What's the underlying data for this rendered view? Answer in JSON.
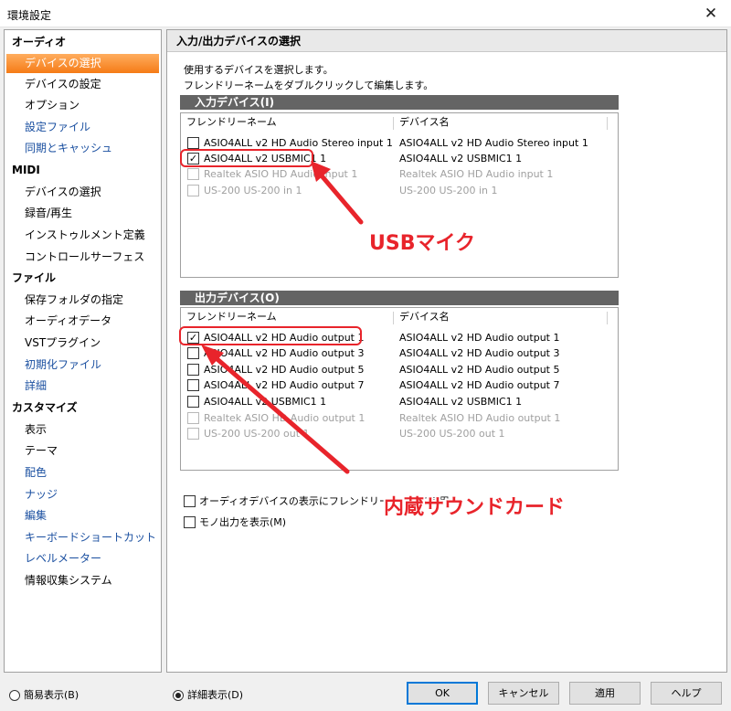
{
  "window": {
    "title": "環境設定",
    "close_icon": "close-icon"
  },
  "sidebar": {
    "items": [
      {
        "label": "オーディオ",
        "kind": "category"
      },
      {
        "label": "デバイスの選択",
        "kind": "selected"
      },
      {
        "label": "デバイスの設定",
        "kind": "sub"
      },
      {
        "label": "オプション",
        "kind": "sub"
      },
      {
        "label": "設定ファイル",
        "kind": "link"
      },
      {
        "label": "同期とキャッシュ",
        "kind": "link"
      },
      {
        "label": "MIDI",
        "kind": "category"
      },
      {
        "label": "デバイスの選択",
        "kind": "sub"
      },
      {
        "label": "録音/再生",
        "kind": "sub"
      },
      {
        "label": "インストゥルメント定義",
        "kind": "sub"
      },
      {
        "label": "コントロールサーフェス",
        "kind": "sub"
      },
      {
        "label": "ファイル",
        "kind": "category"
      },
      {
        "label": "保存フォルダの指定",
        "kind": "sub"
      },
      {
        "label": "オーディオデータ",
        "kind": "sub"
      },
      {
        "label": "VSTプラグイン",
        "kind": "sub"
      },
      {
        "label": "初期化ファイル",
        "kind": "link"
      },
      {
        "label": "詳細",
        "kind": "link"
      },
      {
        "label": "カスタマイズ",
        "kind": "category"
      },
      {
        "label": "表示",
        "kind": "sub"
      },
      {
        "label": "テーマ",
        "kind": "sub"
      },
      {
        "label": "配色",
        "kind": "link"
      },
      {
        "label": "ナッジ",
        "kind": "link"
      },
      {
        "label": "編集",
        "kind": "link"
      },
      {
        "label": "キーボードショートカット",
        "kind": "link"
      },
      {
        "label": "レベルメーター",
        "kind": "link"
      },
      {
        "label": "情報収集システム",
        "kind": "sub"
      }
    ]
  },
  "main": {
    "header": "入力/出力デバイスの選択",
    "desc1": "使用するデバイスを選択します。",
    "desc2": "フレンドリーネームをダブルクリックして編集します。",
    "input_group": {
      "title": "入力デバイス(I)",
      "col_friendly": "フレンドリーネーム",
      "col_device": "デバイス名",
      "rows": [
        {
          "friendly": "ASIO4ALL v2 HD Audio Stereo input 1",
          "device": "ASIO4ALL v2 HD Audio Stereo input 1",
          "checked": false,
          "enabled": true
        },
        {
          "friendly": "ASIO4ALL v2 USBMIC1 1",
          "device": "ASIO4ALL v2 USBMIC1 1",
          "checked": true,
          "enabled": true
        },
        {
          "friendly": "Realtek ASIO HD Audio input 1",
          "device": "Realtek ASIO HD Audio input 1",
          "checked": false,
          "enabled": false
        },
        {
          "friendly": "US-200 US-200 in 1",
          "device": "US-200 US-200 in 1",
          "checked": false,
          "enabled": false
        }
      ]
    },
    "output_group": {
      "title": "出力デバイス(O)",
      "col_friendly": "フレンドリーネーム",
      "col_device": "デバイス名",
      "rows": [
        {
          "friendly": "ASIO4ALL v2 HD Audio output 1",
          "device": "ASIO4ALL v2 HD Audio output 1",
          "checked": true,
          "enabled": true
        },
        {
          "friendly": "ASIO4ALL v2 HD Audio output 3",
          "device": "ASIO4ALL v2 HD Audio output 3",
          "checked": false,
          "enabled": true
        },
        {
          "friendly": "ASIO4ALL v2 HD Audio output 5",
          "device": "ASIO4ALL v2 HD Audio output 5",
          "checked": false,
          "enabled": true
        },
        {
          "friendly": "ASIO4ALL v2 HD Audio output 7",
          "device": "ASIO4ALL v2 HD Audio output 7",
          "checked": false,
          "enabled": true
        },
        {
          "friendly": "ASIO4ALL v2 USBMIC1 1",
          "device": "ASIO4ALL v2 USBMIC1 1",
          "checked": false,
          "enabled": true
        },
        {
          "friendly": "Realtek ASIO HD Audio output 1",
          "device": "Realtek ASIO HD Audio output 1",
          "checked": false,
          "enabled": false
        },
        {
          "friendly": "US-200 US-200 out 1",
          "device": "US-200 US-200 out 1",
          "checked": false,
          "enabled": false
        }
      ]
    },
    "options": {
      "use_friendly": "オーディオデバイスの表示にフレンドリーネームを使用",
      "mono_out": "モノ出力を表示(M)"
    }
  },
  "annotations": {
    "usb_mic": "USBマイク",
    "builtin_sound": "内蔵サウンドカード",
    "color": "#e8242b"
  },
  "footer": {
    "simple_view": "簡易表示(B)",
    "detailed_view": "詳細表示(D)",
    "ok": "OK",
    "cancel": "キャンセル",
    "apply": "適用",
    "help": "ヘルプ"
  }
}
